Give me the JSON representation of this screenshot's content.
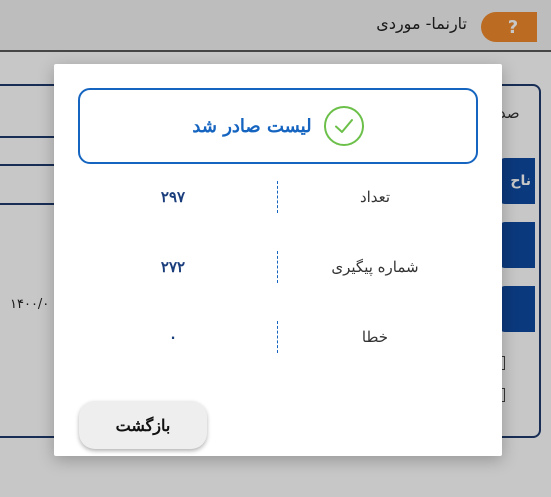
{
  "app": {
    "title": "تارنما- موردی",
    "help_icon": "question-mark-icon",
    "help_glyph": "?",
    "accent_color": "#f08a2c"
  },
  "background": {
    "partial_heading": "صد",
    "partial_tab_label": "ناح",
    "partial_date": "۱۴۰۰/۰"
  },
  "modal": {
    "success_icon": "check-circle-icon",
    "success_message": "لیست صادر شد",
    "success_color": "#1565c0",
    "check_color": "#6cc04a",
    "rows": [
      {
        "label": "تعداد",
        "value": "۲۹۷"
      },
      {
        "label": "شماره  پیگیری",
        "value": "۲۷۲"
      },
      {
        "label": "خطا",
        "value": "۰"
      }
    ],
    "back_label": "بازگشت"
  }
}
